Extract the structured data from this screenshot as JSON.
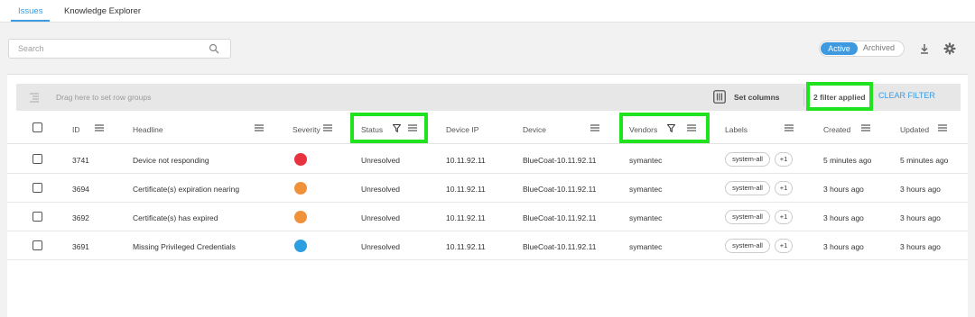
{
  "nav": {
    "tabs": [
      {
        "label": "Issues",
        "active": true
      },
      {
        "label": "Knowledge Explorer",
        "active": false
      }
    ]
  },
  "search": {
    "placeholder": "Search",
    "icon": "search-icon"
  },
  "toggle": {
    "active_label": "Active",
    "archived_label": "Archived"
  },
  "toolbar_icons": [
    "download-icon",
    "gear-icon"
  ],
  "grid": {
    "group_bar_text": "Drag here to set row groups",
    "set_columns_label": "Set columns",
    "filter_status": "2 filter applied",
    "clear_filter_label": "CLEAR FILTER",
    "columns": [
      "ID",
      "Headline",
      "Severity",
      "Status",
      "Device IP",
      "Device",
      "Vendors",
      "Labels",
      "Created",
      "Updated"
    ],
    "filtered_columns": [
      "Status",
      "Vendors"
    ],
    "rows": [
      {
        "id": "3741",
        "headline": "Device not responding",
        "severity_color": "#e8323f",
        "status": "Unresolved",
        "device_ip": "10.11.92.11",
        "device": "BlueCoat-10.11.92.11",
        "vendor": "symantec",
        "label": "system-all",
        "label_more": "+1",
        "created": "5 minutes ago",
        "updated": "5 minutes ago"
      },
      {
        "id": "3694",
        "headline": "Certificate(s) expiration nearing",
        "severity_color": "#f0923a",
        "status": "Unresolved",
        "device_ip": "10.11.92.11",
        "device": "BlueCoat-10.11.92.11",
        "vendor": "symantec",
        "label": "system-all",
        "label_more": "+1",
        "created": "3 hours ago",
        "updated": "3 hours ago"
      },
      {
        "id": "3692",
        "headline": "Certificate(s) has expired",
        "severity_color": "#f0923a",
        "status": "Unresolved",
        "device_ip": "10.11.92.11",
        "device": "BlueCoat-10.11.92.11",
        "vendor": "symantec",
        "label": "system-all",
        "label_more": "+1",
        "created": "3 hours ago",
        "updated": "3 hours ago"
      },
      {
        "id": "3691",
        "headline": "Missing Privileged Credentials",
        "severity_color": "#2d9fe0",
        "status": "Unresolved",
        "device_ip": "10.11.92.11",
        "device": "BlueCoat-10.11.92.11",
        "vendor": "symantec",
        "label": "system-all",
        "label_more": "+1",
        "created": "3 hours ago",
        "updated": "3 hours ago"
      }
    ]
  },
  "colors": {
    "accent": "#3d9ae0",
    "highlight": "#21e21e"
  }
}
